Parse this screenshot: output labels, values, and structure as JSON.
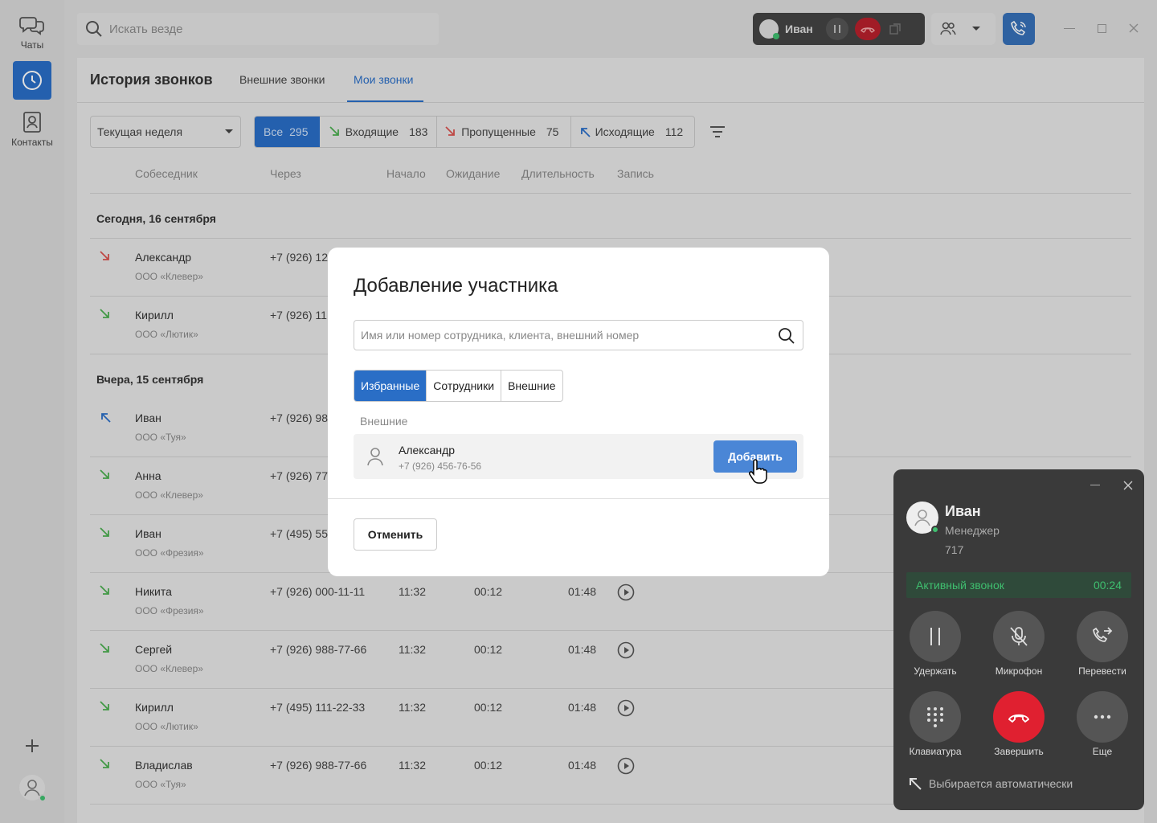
{
  "rail": {
    "chats": "Чаты",
    "contacts": "Контакты"
  },
  "search": {
    "placeholder": "Искать везде"
  },
  "call_pill": {
    "name": "Иван"
  },
  "page": {
    "title": "История звонков",
    "tabs": [
      "Внешние звонки",
      "Мои звонки"
    ]
  },
  "filters": {
    "period": "Текущая неделя",
    "all": {
      "label": "Все",
      "count": "295"
    },
    "incoming": {
      "label": "Входящие",
      "count": "183"
    },
    "missed": {
      "label": "Пропущенные",
      "count": "75"
    },
    "outgoing": {
      "label": "Исходящие",
      "count": "112"
    }
  },
  "columns": [
    "Собеседник",
    "Через",
    "Начало",
    "Ожидание",
    "Длительность",
    "Запись"
  ],
  "groups": [
    {
      "date": "Сегодня, 16 сентября"
    },
    {
      "date": "Вчера, 15 сентября"
    }
  ],
  "rows": [
    {
      "type": "missed",
      "name": "Александр",
      "company": "ООО «Клевер»",
      "via": "+7 (926) 12",
      "start": "",
      "wait": "",
      "dur": ""
    },
    {
      "type": "in",
      "name": "Кирилл",
      "company": "ООО «Лютик»",
      "via": "+7 (926) 11",
      "start": "",
      "wait": "",
      "dur": ""
    },
    {
      "type": "out",
      "name": "Иван",
      "company": "ООО «Туя»",
      "via": "+7 (926) 98",
      "start": "",
      "wait": "",
      "dur": ""
    },
    {
      "type": "in",
      "name": "Анна",
      "company": "ООО «Клевер»",
      "via": "+7 (926) 77",
      "start": "",
      "wait": "",
      "dur": ""
    },
    {
      "type": "in",
      "name": "Иван",
      "company": "ООО «Фрезия»",
      "via": "+7 (495) 55",
      "start": "",
      "wait": "",
      "dur": ""
    },
    {
      "type": "in",
      "name": "Никита",
      "company": "ООО «Фрезия»",
      "via": "+7 (926) 000-11-11",
      "start": "11:32",
      "wait": "00:12",
      "dur": "01:48"
    },
    {
      "type": "in",
      "name": "Сергей",
      "company": "ООО «Клевер»",
      "via": "+7 (926) 988-77-66",
      "start": "11:32",
      "wait": "00:12",
      "dur": "01:48"
    },
    {
      "type": "in",
      "name": "Кирилл",
      "company": "ООО «Лютик»",
      "via": "+7 (495) 111-22-33",
      "start": "11:32",
      "wait": "00:12",
      "dur": "01:48"
    },
    {
      "type": "in",
      "name": "Владислав",
      "company": "ООО «Туя»",
      "via": "+7 (926) 988-77-66",
      "start": "11:32",
      "wait": "00:12",
      "dur": "01:48"
    }
  ],
  "modal": {
    "title": "Добавление участника",
    "search_placeholder": "Имя или номер сотрудника, клиента, внешний номер",
    "segments": [
      "Избранные",
      "Сотрудники",
      "Внешние"
    ],
    "section": "Внешние",
    "contact": {
      "name": "Александр",
      "phone": "+7 (926) 456-76-56"
    },
    "add": "Добавить",
    "cancel": "Отменить"
  },
  "call_widget": {
    "name": "Иван",
    "role": "Менеджер",
    "ext": "717",
    "status": "Активный звонок",
    "timer": "00:24",
    "buttons": [
      "Удержать",
      "Микрофон",
      "Перевести",
      "Клавиатура",
      "Завершить",
      "Еще"
    ],
    "auto": "Выбирается автоматически"
  },
  "colors": {
    "accent": "#2a6ec6",
    "missed": "#d9534f",
    "incoming": "#4caf50",
    "end_call": "#e02030",
    "status_green": "#3fbf6f"
  }
}
